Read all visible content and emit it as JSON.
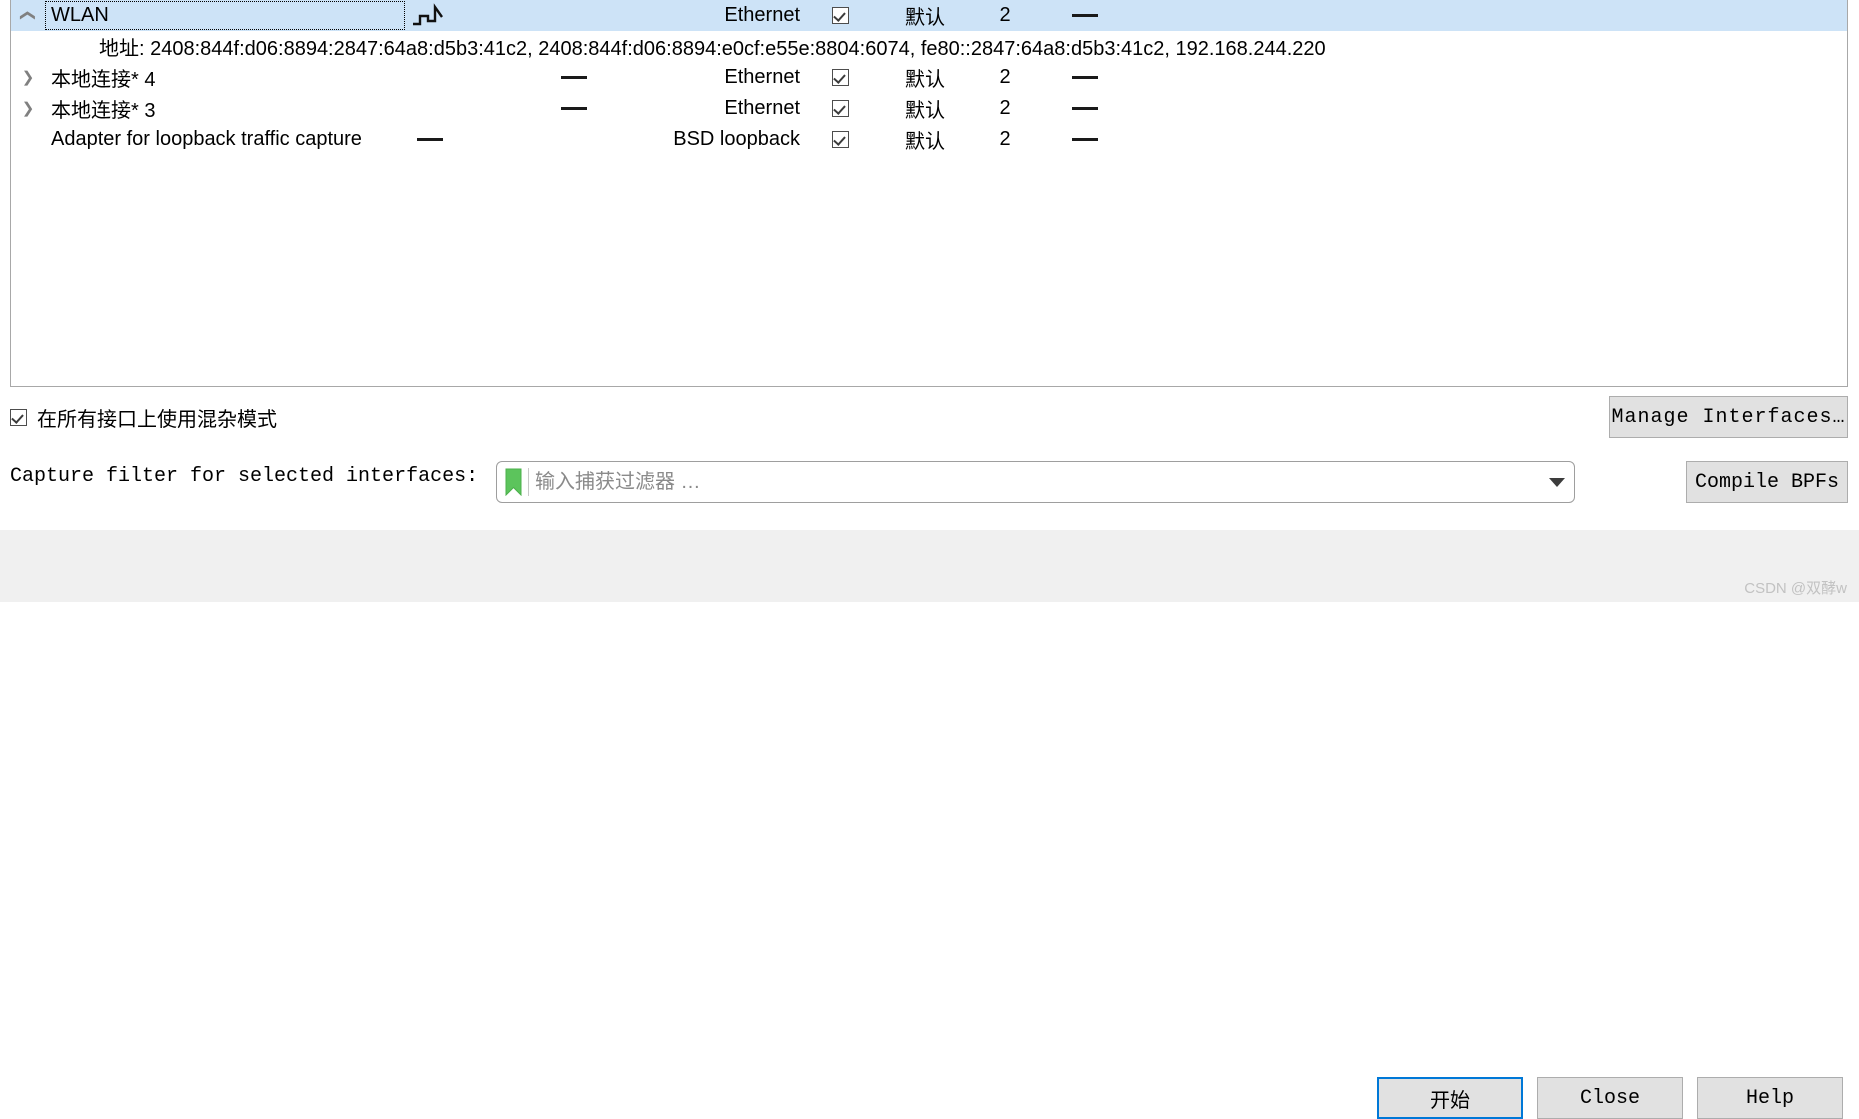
{
  "interface_list": {
    "columns": [
      "name",
      "traffic",
      "link_layer_header",
      "promiscuous",
      "snaplen",
      "buffer",
      "monitor_mode"
    ],
    "rows": [
      {
        "name": "WLAN",
        "expander": "chevron-down",
        "traffic": "sparkline",
        "link_layer_header": "Ethernet",
        "promiscuous": true,
        "snaplen": "默认",
        "buffer": "2",
        "monitor_mode": "—",
        "selected": true,
        "detail": "地址: 2408:844f:d06:8894:2847:64a8:d5b3:41c2, 2408:844f:d06:8894:e0cf:e55e:8804:6074, fe80::2847:64a8:d5b3:41c2, 192.168.244.220"
      },
      {
        "name": "本地连接* 4",
        "expander": "chevron-right",
        "traffic": "—",
        "link_layer_header": "Ethernet",
        "promiscuous": true,
        "snaplen": "默认",
        "buffer": "2",
        "monitor_mode": "—",
        "selected": false
      },
      {
        "name": "本地连接* 3",
        "expander": "chevron-right",
        "traffic": "—",
        "link_layer_header": "Ethernet",
        "promiscuous": true,
        "snaplen": "默认",
        "buffer": "2",
        "monitor_mode": "—",
        "selected": false
      },
      {
        "name": "Adapter for loopback traffic capture",
        "expander": "",
        "traffic": "—",
        "link_layer_header": "BSD loopback",
        "promiscuous": true,
        "snaplen": "默认",
        "buffer": "2",
        "monitor_mode": "—",
        "selected": false
      }
    ]
  },
  "options": {
    "promiscuous_all_label": "在所有接口上使用混杂模式",
    "promiscuous_all_checked": true,
    "manage_interfaces_label": "Manage Interfaces…"
  },
  "capture_filter": {
    "label": "Capture filter for selected interfaces:",
    "placeholder": "输入捕获过滤器 …",
    "value": "",
    "bookmark_icon": "bookmark-icon",
    "dropdown_icon": "chevron-down-icon",
    "compile_label": "Compile BPFs"
  },
  "footer": {
    "start_label": "开始",
    "close_label": "Close",
    "help_label": "Help"
  },
  "watermark": "CSDN @双酵w",
  "colors": {
    "selection": "#cde3f7",
    "focus_border": "#0078d7",
    "bookmark_green": "#5cc45c",
    "button_face": "#e1e1e1",
    "panel": "#f0f0f0"
  }
}
